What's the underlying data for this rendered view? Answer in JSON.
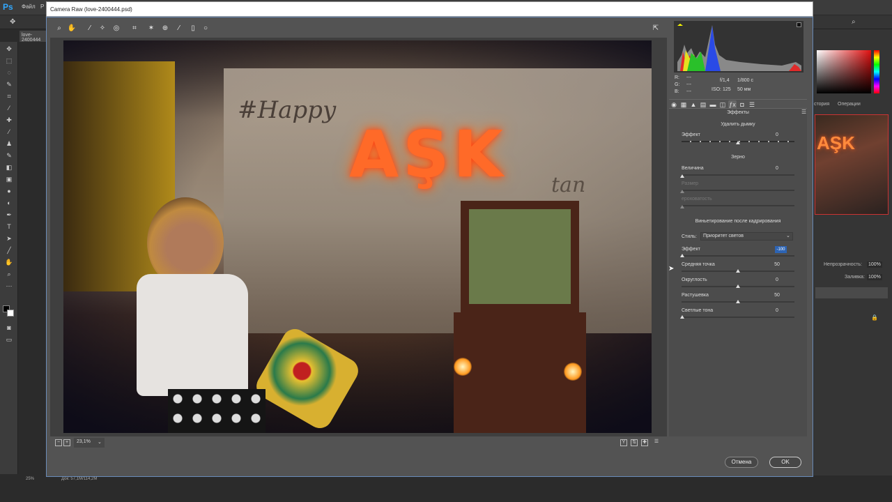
{
  "photoshop": {
    "logo": "Ps",
    "menu": [
      "Файл",
      "Р"
    ],
    "doc_tab": "love-2400444",
    "status_zoom": "25%",
    "status_doc": "Док: 57,1M/114,2M",
    "right_panel": {
      "history_tab": "стория",
      "operations_tab": "Операции",
      "opacity_label": "Непрозрачность:",
      "opacity_value": "100%",
      "fill_label": "Заливка:",
      "fill_value": "100%",
      "thumb_text": "AŞK"
    }
  },
  "dialog": {
    "title": "Camera Raw (love-2400444.psd)",
    "zoom": "23,1%",
    "photo": {
      "sign": "AŞK",
      "script_text": "#Happy",
      "script_text_2": "tan"
    },
    "info": {
      "r_label": "R:",
      "r_value": "---",
      "g_label": "G:",
      "g_value": "---",
      "b_label": "B:",
      "b_value": "---",
      "aperture": "f/1,4",
      "shutter": "1/800 с",
      "iso": "ISO: 125",
      "focal": "50 мм"
    },
    "panel": {
      "title": "Эффекты",
      "dehaze": {
        "title": "Удалить дымку",
        "effect_label": "Эффект",
        "effect_value": "0"
      },
      "grain": {
        "title": "Зерно",
        "amount_label": "Величина",
        "amount_value": "0",
        "size_label": "Размер",
        "roughness_label": "ероховатость"
      },
      "vignette": {
        "title": "Виньетирование после кадрирования",
        "style_label": "Стиль:",
        "style_value": "Приоритет светов",
        "effect_label": "Эффект",
        "effect_value": "-100",
        "midpoint_label": "Средняя точка",
        "midpoint_value": "50",
        "roundness_label": "Округлость",
        "roundness_value": "0",
        "feather_label": "Растушевка",
        "feather_value": "50",
        "highlights_label": "Светлые тона",
        "highlights_value": "0"
      }
    },
    "buttons": {
      "cancel": "Отмена",
      "ok": "OK"
    }
  },
  "colors": {
    "dialog_bg": "#535353",
    "accent_blue": "#2d64b4",
    "sign_orange": "#ff6a28"
  }
}
